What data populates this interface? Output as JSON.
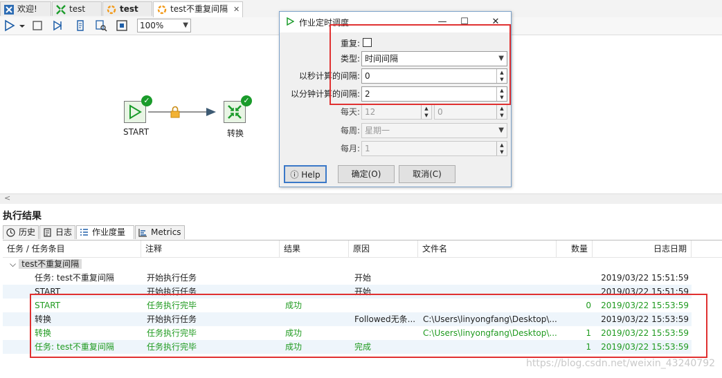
{
  "tabs": [
    {
      "label": "欢迎!",
      "icon": "welcome-icon"
    },
    {
      "label": "test",
      "icon": "transformation-icon"
    },
    {
      "label": "test",
      "icon": "job-icon"
    },
    {
      "label": "test不重复间隔",
      "icon": "job-icon",
      "close": "✕"
    }
  ],
  "toolbar": {
    "zoom": "100%"
  },
  "canvas": {
    "start_label": "START",
    "transform_label": "转换"
  },
  "dialog": {
    "title": "作业定时调度",
    "repeat_label": "重复:",
    "type_label": "类型:",
    "type_value": "时间间隔",
    "seconds_label": "以秒计算的间隔:",
    "seconds_value": "0",
    "minutes_label": "以分钟计算的间隔:",
    "minutes_value": "2",
    "daily_label": "每天:",
    "daily_hour": "12",
    "daily_minute": "0",
    "weekly_label": "每周:",
    "weekly_value": "星期一",
    "monthly_label": "每月:",
    "monthly_value": "1",
    "help_label": "Help",
    "ok_label": "确定(O)",
    "cancel_label": "取消(C)"
  },
  "results": {
    "title": "执行结果",
    "tabs": [
      "历史",
      "日志",
      "作业度量",
      "Metrics"
    ],
    "columns": [
      "任务 / 任务条目",
      "注释",
      "结果",
      "原因",
      "文件名",
      "数量",
      "日志日期"
    ],
    "group": "test不重复间隔",
    "rows": [
      {
        "task": "任务: test不重复间隔",
        "note": "开始执行任务",
        "result": "",
        "reason": "开始",
        "file": "",
        "count": "",
        "date": "2019/03/22 15:51:59",
        "green": false
      },
      {
        "task": "START",
        "note": "开始执行任务",
        "result": "",
        "reason": "开始",
        "file": "",
        "count": "",
        "date": "2019/03/22 15:51:59",
        "green": false
      },
      {
        "task": "START",
        "note": "任务执行完毕",
        "result": "成功",
        "reason": "",
        "file": "",
        "count": "0",
        "date": "2019/03/22 15:53:59",
        "green": true
      },
      {
        "task": "转换",
        "note": "开始执行任务",
        "result": "",
        "reason": "Followed无条...",
        "file": "C:\\Users\\linyongfang\\Desktop\\...",
        "count": "",
        "date": "2019/03/22 15:53:59",
        "green": false
      },
      {
        "task": "转换",
        "note": "任务执行完毕",
        "result": "成功",
        "reason": "",
        "file": "C:\\Users\\linyongfang\\Desktop\\...",
        "count": "1",
        "date": "2019/03/22 15:53:59",
        "green": true
      },
      {
        "task": "任务: test不重复间隔",
        "note": "任务执行完毕",
        "result": "成功",
        "reason": "完成",
        "file": "",
        "count": "1",
        "date": "2019/03/22 15:53:59",
        "green": true
      }
    ]
  },
  "watermark": "https://blog.csdn.net/weixin_43240792"
}
